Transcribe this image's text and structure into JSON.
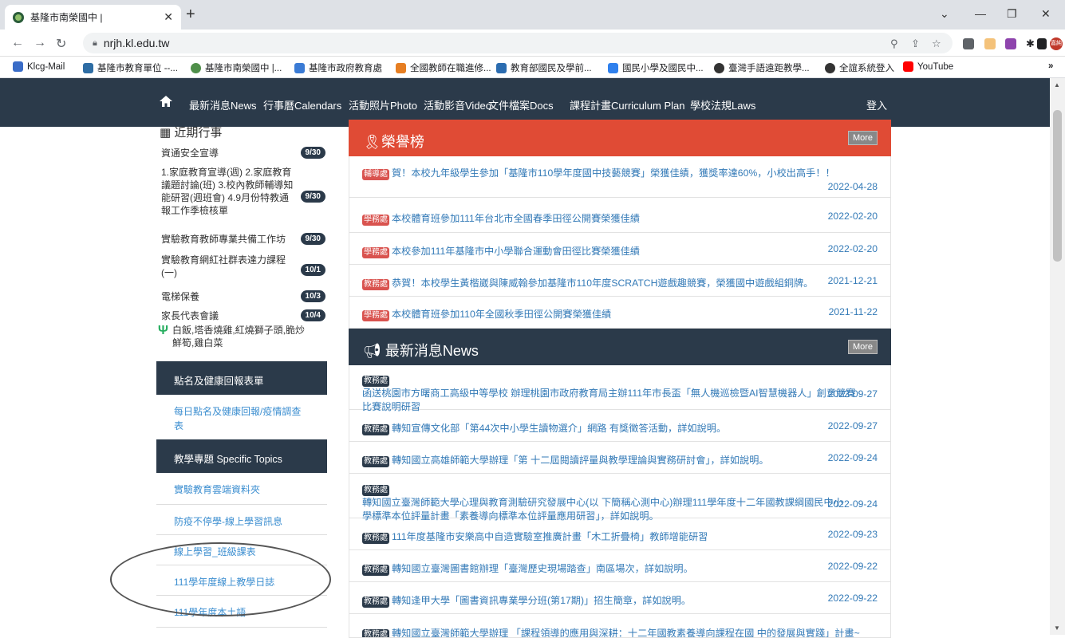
{
  "browser": {
    "tab_title": "基隆市南榮國中 |",
    "url": "nrjh.kl.edu.tw",
    "bookmarks": [
      "Klcg-Mail",
      "基隆市教育單位 --...",
      "基隆市南榮國中 |...",
      "基隆市政府教育處",
      "全國教師在職進修...",
      "教育部國民及學前...",
      "國民小學及國民中...",
      "臺灣手語遠距教學...",
      "全誼系統登入",
      "YouTube"
    ],
    "profile": "嘉純"
  },
  "sitenav": {
    "items": [
      "最新消息News",
      "行事曆Calendars",
      "活動照片Photo",
      "活動影音Video",
      "文件檔案Docs",
      "課程計畫Curriculum Plan",
      "學校法規Laws"
    ],
    "login": "登入"
  },
  "left": {
    "calendar_title": "近期行事",
    "events": [
      {
        "text": "資通安全宣導",
        "date": "9/30"
      },
      {
        "text": "1.家庭教育宣導(週) 2.家庭教育議題討論(班) 3.校內教師輔導知能研習(週班會) 4.9月份特教通報工作季檢核單",
        "date": "9/30"
      },
      {
        "text": "實驗教育教師專業共備工作坊",
        "date": "9/30"
      },
      {
        "text": "實驗教育網紅社群表達力課程(一)",
        "date": "10/1"
      },
      {
        "text": "電梯保養",
        "date": "10/3"
      },
      {
        "text": "家長代表會議",
        "date": "10/4"
      }
    ],
    "lunch": "白飯,塔香燒雞,紅燒獅子頭,脆炒鮮筍,雞白菜",
    "health_title": "點名及健康回報表單",
    "health_link": "每日點名及健康回報/疫情調查表",
    "topics_title": "教學專題 Specific Topics",
    "topics": [
      "實驗教育雲端資料夾",
      "防疫不停學-線上學習訊息",
      "線上學習_班級課表",
      "111學年度線上教學日誌",
      "111學年度本土語"
    ]
  },
  "honor": {
    "title": "榮譽榜",
    "more": "More",
    "items": [
      {
        "tag": "輔導處",
        "text": "賀！本校九年級學生參加「基隆市110學年度國中技藝競賽」榮獲佳績，獲獎率達60%，小校出高手！！",
        "date": "2022-04-28"
      },
      {
        "tag": "學務處",
        "text": "本校體育班參加111年台北市全國春季田徑公開賽榮獲佳績",
        "date": "2022-02-20"
      },
      {
        "tag": "學務處",
        "text": "本校參加111年基隆市中小學聯合運動會田徑比賽榮獲佳績",
        "date": "2022-02-20"
      },
      {
        "tag": "教務處",
        "text": "恭賀！本校學生黃楷崴與陳威翰參加基隆市110年度SCRATCH遊戲趣競賽，榮獲國中遊戲組銅牌。",
        "date": "2021-12-21"
      },
      {
        "tag": "學務處",
        "text": "本校體育班參加110年全國秋季田徑公開賽榮獲佳績",
        "date": "2021-11-22"
      }
    ]
  },
  "news": {
    "title": "最新消息News",
    "more": "More",
    "items": [
      {
        "tag": "教務處",
        "text": "函送桃園市方曙商工高級中等學校 辦理桃園市政府教育局主辦111年市長盃「無人機巡檢暨AI智慧機器人」創意競賽比賽說明研習",
        "date": "2022-09-27"
      },
      {
        "tag": "教務處",
        "text": "轉知宣傳文化部「第44次中小學生讀物選介」網路 有獎徵答活動，詳如說明。",
        "date": "2022-09-27"
      },
      {
        "tag": "教務處",
        "text": "轉知國立高雄師範大學辦理「第 十二屆閱讀評量與教學理論與實務研討會」，詳如說明。",
        "date": "2022-09-24"
      },
      {
        "tag": "教務處",
        "text": "轉知國立臺灣師範大學心理與教育測驗研究發展中心(以 下簡稱心測中心)辦理111學年度十二年國教課綱國民中小 學標準本位評量計畫「素養導向標準本位評量應用研習」，詳如說明。",
        "date": "2022-09-24"
      },
      {
        "tag": "教務處",
        "text": "111年度基隆市安樂高中自造實驗室推廣計畫「木工折疊椅」教師增能研習",
        "date": "2022-09-23"
      },
      {
        "tag": "教務處",
        "text": "轉知國立臺灣圖書館辦理「臺灣歷史現場踏查」南區場次，詳如說明。",
        "date": "2022-09-22"
      },
      {
        "tag": "教務處",
        "text": "轉知逢甲大學「圖書資訊專業學分班(第17期)」招生簡章，詳如說明。",
        "date": "2022-09-22"
      },
      {
        "tag": "教務處",
        "text": "轉知國立臺灣師範大學辦理 「課程領導的應用與深耕：十二年國教素養導向課程在國 中的發展與實踐」計畫~",
        "date": ""
      }
    ]
  }
}
